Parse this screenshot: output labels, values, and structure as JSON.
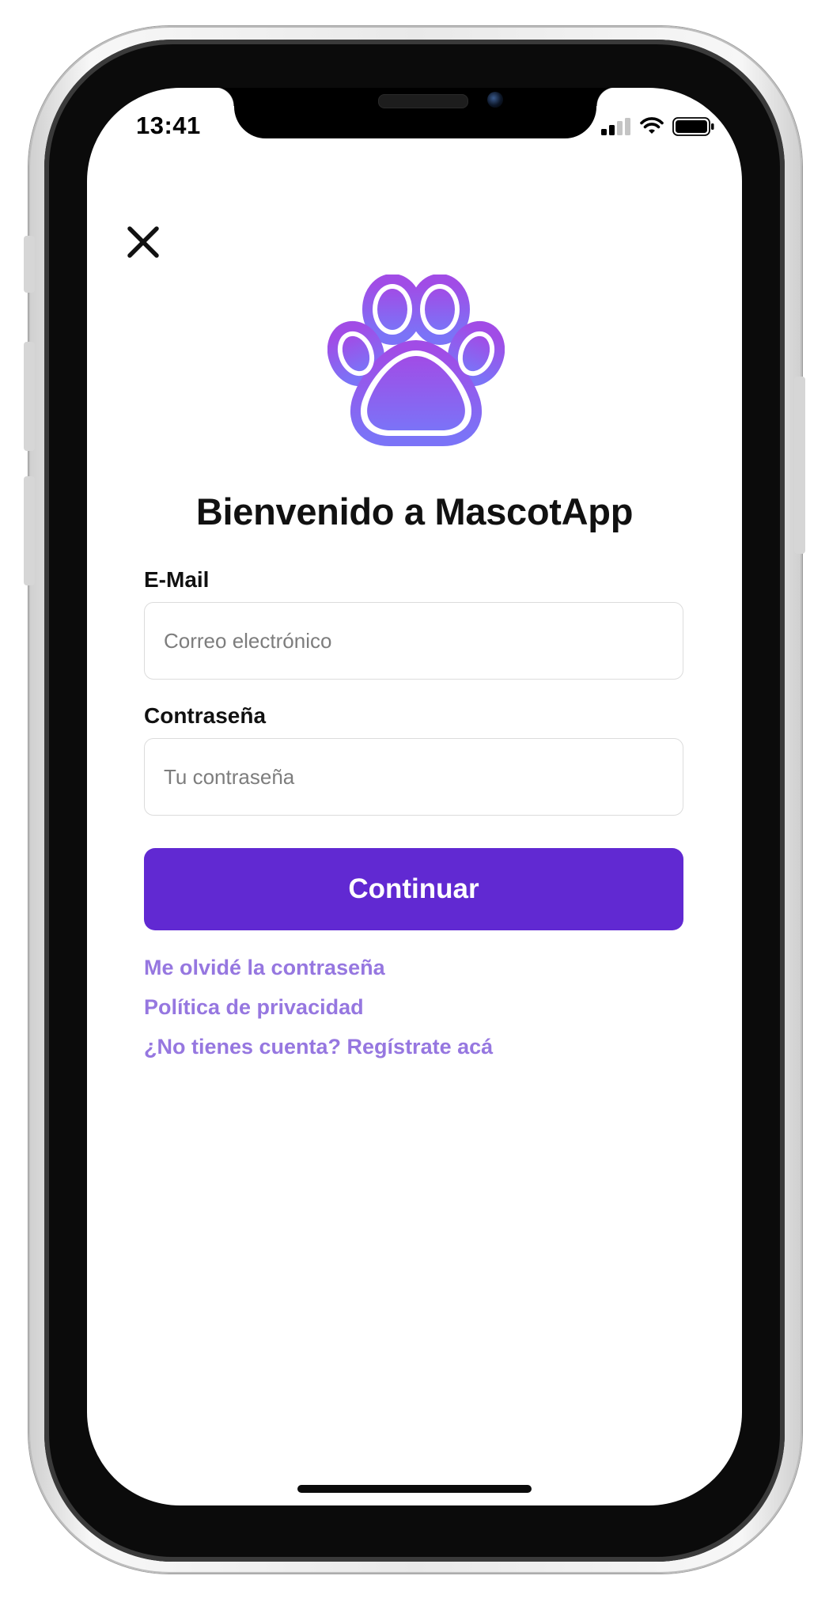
{
  "status_bar": {
    "time": "13:41",
    "icons": [
      "cellular-signal-icon",
      "wifi-icon",
      "battery-icon"
    ]
  },
  "nav": {
    "close_icon": "close-icon"
  },
  "logo": {
    "icon": "paw-icon",
    "gradient_top": "#a14ce6",
    "gradient_bottom": "#7b73f7"
  },
  "title": "Bienvenido a MascotApp",
  "form": {
    "email_label": "E-Mail",
    "email_placeholder": "Correo electrónico",
    "email_value": "",
    "password_label": "Contraseña",
    "password_placeholder": "Tu contraseña",
    "password_value": "",
    "submit_label": "Continuar"
  },
  "links": {
    "forgot_password": "Me olvidé la contraseña",
    "privacy_policy": "Política de privacidad",
    "register": "¿No tienes cuenta? Regístrate acá"
  },
  "colors": {
    "primary": "#6129d2",
    "link": "#9677e0",
    "text": "#111111",
    "field_border": "#dcdcdc"
  }
}
